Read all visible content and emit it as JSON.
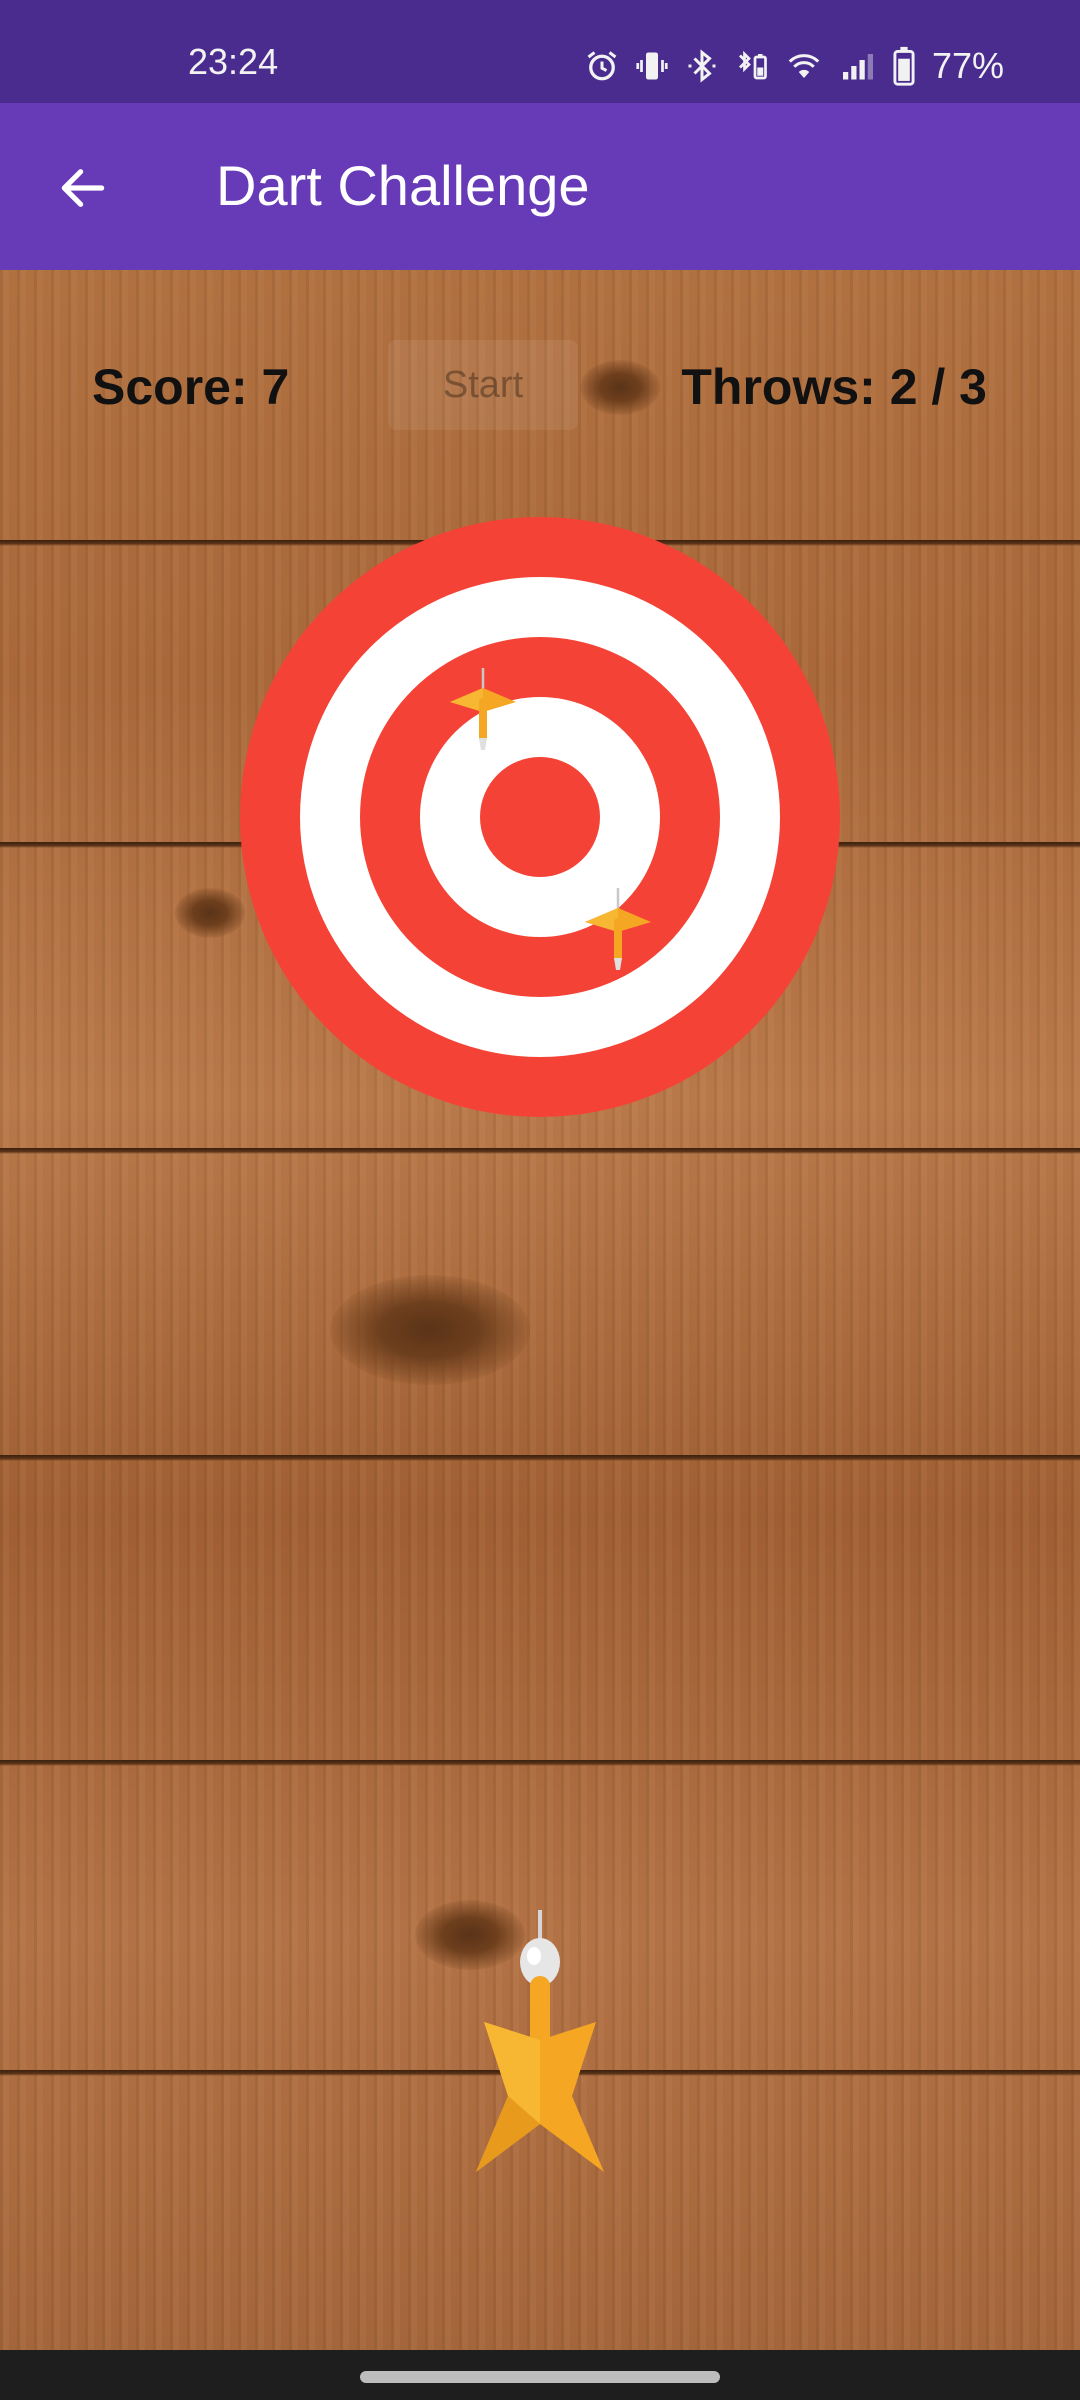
{
  "status_bar": {
    "time": "23:24",
    "battery": "77%",
    "icons": [
      "alarm-icon",
      "vibrate-icon",
      "bluetooth-icon",
      "battery-saver-icon",
      "wifi-icon",
      "signal-icon",
      "battery-icon"
    ]
  },
  "app_bar": {
    "back_icon": "arrow-left-icon",
    "title": "Dart Challenge",
    "color": "#673ab7"
  },
  "game": {
    "score_text": "Score: 7",
    "start_label": "Start",
    "throws_text": "Throws: 2 / 3",
    "target_colors": {
      "red": "#f44336",
      "white": "#ffffff"
    },
    "dart_color": "#f5a623"
  }
}
